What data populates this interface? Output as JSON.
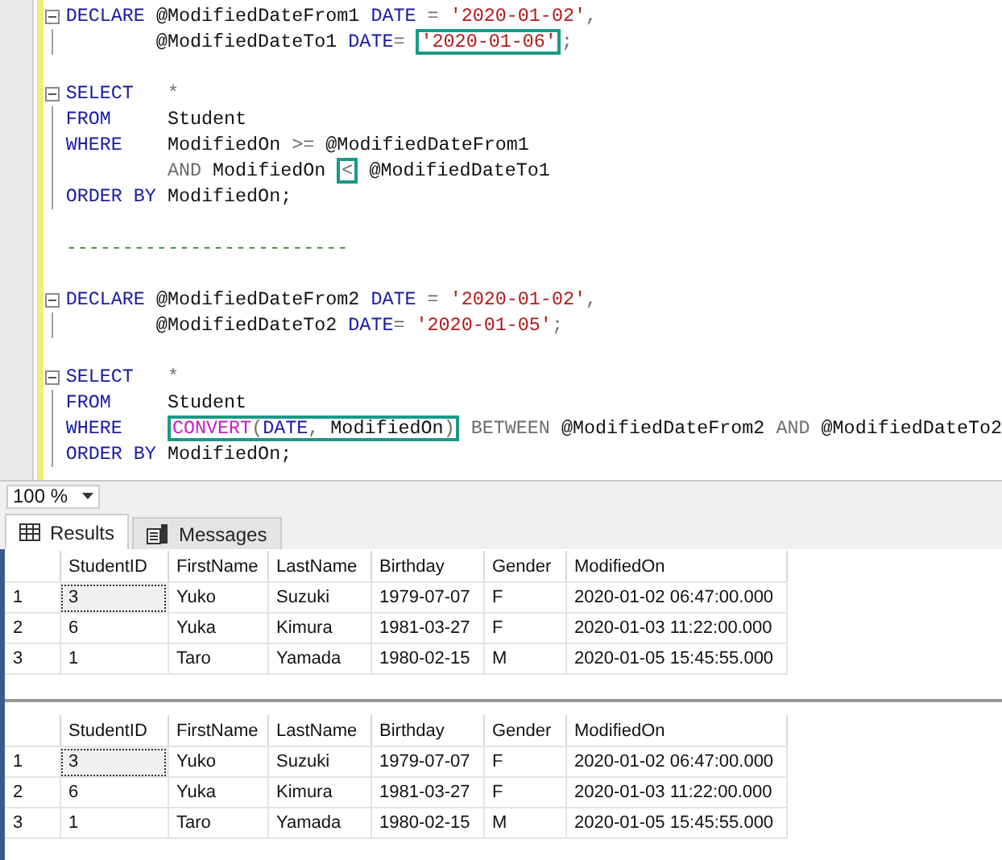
{
  "editor": {
    "lines": [
      {
        "kind": "fold_start",
        "tokens": [
          {
            "kind": "kw",
            "text": "DECLARE"
          },
          {
            "kind": "plain",
            "text": " @ModifiedDateFrom1"
          },
          {
            "kind": "kw",
            "text": " DATE"
          },
          {
            "kind": "op",
            "text": " ="
          },
          {
            "kind": "str",
            "text": " '2020-01-02'"
          },
          {
            "kind": "op",
            "text": ","
          }
        ]
      },
      {
        "kind": "fold_body",
        "tokens": [
          {
            "kind": "plain",
            "text": "        @ModifiedDateTo1"
          },
          {
            "kind": "kw",
            "text": " DATE"
          },
          {
            "kind": "op",
            "text": "= "
          },
          {
            "kind": "box",
            "tokens": [
              {
                "kind": "str",
                "text": "'2020-01-06'"
              }
            ]
          },
          {
            "kind": "op",
            "text": ";"
          }
        ]
      },
      {
        "kind": "empty"
      },
      {
        "kind": "fold_start",
        "tokens": [
          {
            "kind": "kw",
            "text": "SELECT"
          },
          {
            "kind": "op",
            "text": "   *"
          }
        ]
      },
      {
        "kind": "fold_body",
        "tokens": [
          {
            "kind": "kw",
            "text": "FROM"
          },
          {
            "kind": "plain",
            "text": "     Student"
          }
        ]
      },
      {
        "kind": "fold_body",
        "tokens": [
          {
            "kind": "kw",
            "text": "WHERE"
          },
          {
            "kind": "plain",
            "text": "    ModifiedOn"
          },
          {
            "kind": "op",
            "text": " >="
          },
          {
            "kind": "plain",
            "text": " @ModifiedDateFrom1"
          }
        ]
      },
      {
        "kind": "fold_body",
        "tokens": [
          {
            "kind": "op",
            "text": "         AND"
          },
          {
            "kind": "plain",
            "text": " ModifiedOn "
          },
          {
            "kind": "box",
            "tokens": [
              {
                "kind": "op",
                "text": "<"
              }
            ]
          },
          {
            "kind": "plain",
            "text": " @ModifiedDateTo1"
          }
        ]
      },
      {
        "kind": "fold_body",
        "tokens": [
          {
            "kind": "kw",
            "text": "ORDER BY"
          },
          {
            "kind": "plain",
            "text": " ModifiedOn;"
          }
        ]
      },
      {
        "kind": "empty"
      },
      {
        "kind": "text",
        "tokens": [
          {
            "kind": "comment",
            "text": "-------------------------"
          }
        ]
      },
      {
        "kind": "empty"
      },
      {
        "kind": "fold_start",
        "tokens": [
          {
            "kind": "kw",
            "text": "DECLARE"
          },
          {
            "kind": "plain",
            "text": " @ModifiedDateFrom2"
          },
          {
            "kind": "kw",
            "text": " DATE"
          },
          {
            "kind": "op",
            "text": " ="
          },
          {
            "kind": "str",
            "text": " '2020-01-02'"
          },
          {
            "kind": "op",
            "text": ","
          }
        ]
      },
      {
        "kind": "fold_body",
        "tokens": [
          {
            "kind": "plain",
            "text": "        @ModifiedDateTo2"
          },
          {
            "kind": "kw",
            "text": " DATE"
          },
          {
            "kind": "op",
            "text": "="
          },
          {
            "kind": "str",
            "text": " '2020-01-05'"
          },
          {
            "kind": "op",
            "text": ";"
          }
        ]
      },
      {
        "kind": "empty"
      },
      {
        "kind": "fold_start",
        "tokens": [
          {
            "kind": "kw",
            "text": "SELECT"
          },
          {
            "kind": "op",
            "text": "   *"
          }
        ]
      },
      {
        "kind": "fold_body",
        "tokens": [
          {
            "kind": "kw",
            "text": "FROM"
          },
          {
            "kind": "plain",
            "text": "     Student"
          }
        ]
      },
      {
        "kind": "fold_body",
        "tokens": [
          {
            "kind": "kw",
            "text": "WHERE    "
          },
          {
            "kind": "box",
            "tokens": [
              {
                "kind": "fn",
                "text": "CONVERT"
              },
              {
                "kind": "op",
                "text": "("
              },
              {
                "kind": "kw",
                "text": "DATE"
              },
              {
                "kind": "op",
                "text": ","
              },
              {
                "kind": "plain",
                "text": " ModifiedOn"
              },
              {
                "kind": "op",
                "text": ")"
              }
            ]
          },
          {
            "kind": "op",
            "text": " BETWEEN"
          },
          {
            "kind": "plain",
            "text": " @ModifiedDateFrom2"
          },
          {
            "kind": "op",
            "text": " AND"
          },
          {
            "kind": "plain",
            "text": " @ModifiedDateTo2"
          }
        ]
      },
      {
        "kind": "fold_body",
        "tokens": [
          {
            "kind": "kw",
            "text": "ORDER BY"
          },
          {
            "kind": "plain",
            "text": " ModifiedOn;"
          }
        ]
      }
    ]
  },
  "zoom": "100 %",
  "tabs": [
    {
      "label": "Results",
      "selected": true
    },
    {
      "label": "Messages",
      "selected": false
    }
  ],
  "result_grids": [
    {
      "columns": [
        "StudentID",
        "FirstName",
        "LastName",
        "Birthday",
        "Gender",
        "ModifiedOn"
      ],
      "rows": [
        {
          "number": "1",
          "focused": true,
          "cells": [
            "3",
            "Yuko",
            "Suzuki",
            "1979-07-07",
            "F",
            "2020-01-02 06:47:00.000"
          ]
        },
        {
          "number": "2",
          "focused": false,
          "cells": [
            "6",
            "Yuka",
            "Kimura",
            "1981-03-27",
            "F",
            "2020-01-03 11:22:00.000"
          ]
        },
        {
          "number": "3",
          "focused": false,
          "cells": [
            "1",
            "Taro",
            "Yamada",
            "1980-02-15",
            "M",
            "2020-01-05 15:45:55.000"
          ]
        }
      ]
    },
    {
      "columns": [
        "StudentID",
        "FirstName",
        "LastName",
        "Birthday",
        "Gender",
        "ModifiedOn"
      ],
      "rows": [
        {
          "number": "1",
          "focused": true,
          "cells": [
            "3",
            "Yuko",
            "Suzuki",
            "1979-07-07",
            "F",
            "2020-01-02 06:47:00.000"
          ]
        },
        {
          "number": "2",
          "focused": false,
          "cells": [
            "6",
            "Yuka",
            "Kimura",
            "1981-03-27",
            "F",
            "2020-01-03 11:22:00.000"
          ]
        },
        {
          "number": "3",
          "focused": false,
          "cells": [
            "1",
            "Taro",
            "Yamada",
            "1980-02-15",
            "M",
            "2020-01-05 15:45:55.000"
          ]
        }
      ]
    }
  ]
}
